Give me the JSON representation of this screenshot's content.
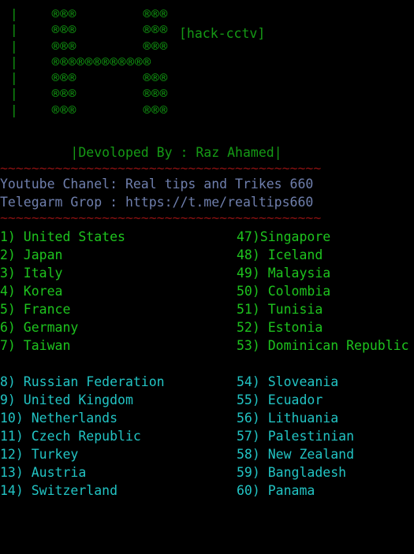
{
  "terminal": {
    "background": "#000000",
    "colors": {
      "banner_green": "#119911",
      "green": "#1ec41e",
      "dark_green": "#159a15",
      "cyan": "#22c4c4",
      "separator_red": "#8a1111",
      "contact_blue": "#6f7fad"
    }
  },
  "banner": {
    "title": "[hack-cctv]",
    "glyph": "®",
    "rows": [
      "|    ®®®        ®®®",
      "|    ®®®        ®®®",
      "|    ®®®        ®®®",
      "|    ®®®®®®®®®®®®",
      "|    ®®®        ®®®",
      "|    ®®®        ®®®",
      "|    ®®®        ®®®"
    ]
  },
  "credits": {
    "developer_line": "         |Devoloped By : Raz Ahamed|",
    "separator": "~~~~~~~~~~~~~~~~~~~~~~~~~~~~~~~~~~~~~~~~~",
    "youtube": "Youtube Chanel: Real tips and Trikes 660",
    "telegram": "Telegarm Grop : https://t.me/realtips660"
  },
  "country_list": {
    "group_green": {
      "left": [
        "1) United States",
        "2) Japan",
        "3) Italy",
        "4) Korea",
        "5) France",
        "6) Germany",
        "7) Taiwan"
      ],
      "right": [
        "47)Singapore",
        "48) Iceland",
        "49) Malaysia",
        "50) Colombia",
        "51) Tunisia",
        "52) Estonia",
        "53) Dominican Republic"
      ]
    },
    "group_cyan": {
      "left": [
        "8) Russian Federation",
        "9) United Kingdom",
        "10) Netherlands",
        "11) Czech Republic",
        "12) Turkey",
        "13) Austria",
        "14) Switzerland"
      ],
      "right": [
        "54) Sloveania",
        "55) Ecuador",
        "56) Lithuania",
        "57) Palestinian",
        "58) New Zealand",
        "59) Bangladesh",
        "60) Panama"
      ]
    }
  }
}
